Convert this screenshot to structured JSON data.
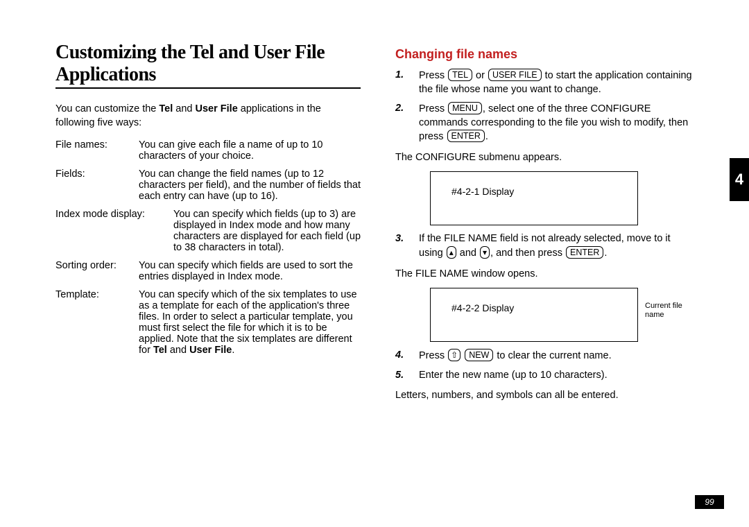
{
  "left": {
    "title": "Customizing the Tel and User File Applications",
    "intro_pre": "You can customize the ",
    "intro_b1": "Tel",
    "intro_mid": " and ",
    "intro_b2": "User File",
    "intro_post": " applications in the following five ways:",
    "rows": {
      "file_names_label": "File names:",
      "file_names_val": "You can give each file a name of up to 10 characters of your choice.",
      "fields_label": "Fields:",
      "fields_val": "You can change the field names (up to 12 characters per field), and the number of fields that each entry can have (up to 16).",
      "index_label": "Index mode display:",
      "index_val": "You can specify which fields (up to 3) are displayed in Index mode and how many characters are displayed for each field (up to 38 characters in total).",
      "sorting_label": "Sorting order:",
      "sorting_val": "You can specify which fields are used to sort the entries displayed in Index mode.",
      "template_label": "Template:",
      "template_val_pre": "You can specify which of the six templates to use as a template for each of the application's three files. In order to select a particular template, you must first select the file for which it is to be applied. Note that the six templates are different for ",
      "template_b1": "Tel",
      "template_mid": " and ",
      "template_b2": "User File",
      "template_post": "."
    }
  },
  "right": {
    "heading": "Changing file names",
    "step1_pre": "Press ",
    "key_tel": "TEL",
    "step1_or": " or ",
    "key_userfile": "USER FILE",
    "step1_post": " to start the application containing the file whose name you want to change.",
    "step2_pre": "Press ",
    "key_menu": "MENU",
    "step2_mid": ", select one of the three CONFIGURE commands corresponding to the file you wish to modify, then press ",
    "key_enter": "ENTER",
    "step2_post": ".",
    "after_step2": "The CONFIGURE submenu appears.",
    "display1": "#4-2-1 Display",
    "step3_pre": "If the FILE NAME field is not already selected, move to it using ",
    "key_up": "▴",
    "step3_and": " and ",
    "key_down": "▾",
    "step3_mid": ", and then press ",
    "step3_post": ".",
    "after_step3": "The FILE NAME window opens.",
    "display2": "#4-2-2 Display",
    "display2_note": "Current file name",
    "step4_pre": "Press ",
    "key_shift": "⇧",
    "key_new": "NEW",
    "step4_post": " to clear the current name.",
    "step5": "Enter the new name (up to 10 characters).",
    "after_step5": "Letters, numbers, and symbols can all be entered."
  },
  "side_tab": "4",
  "page_number": "99",
  "step_numbers": {
    "s1": "1.",
    "s2": "2.",
    "s3": "3.",
    "s4": "4.",
    "s5": "5."
  }
}
